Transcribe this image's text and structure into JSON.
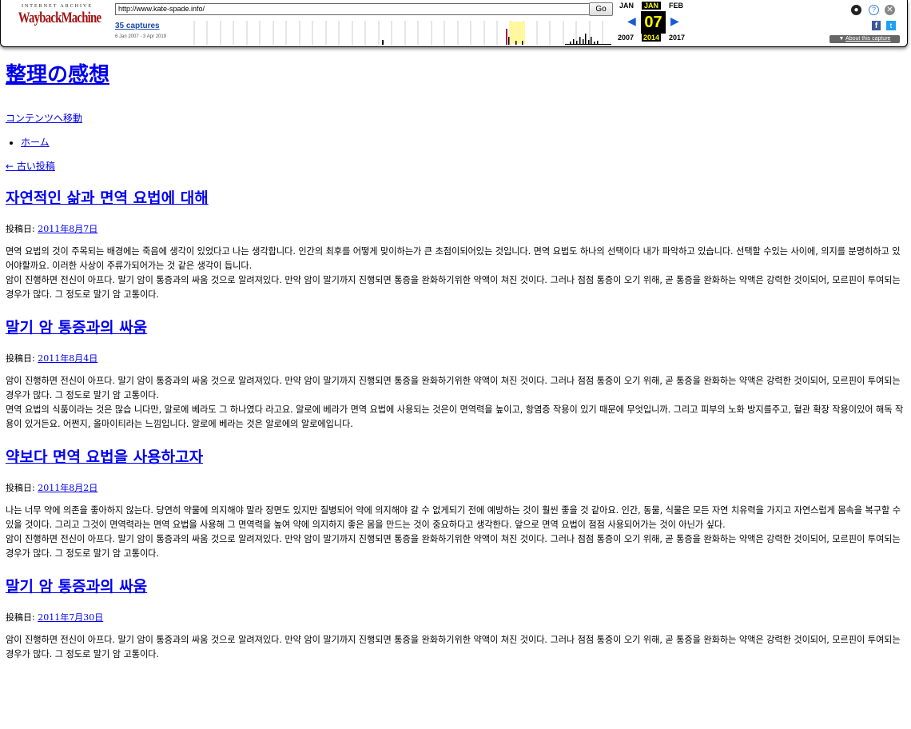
{
  "wayback": {
    "archive_label": "INTERNET ARCHIVE",
    "logo_text": "WaybackMachine",
    "url": "http://www.kate-spade.info/",
    "go_label": "Go",
    "captures": "35 captures",
    "date_range": "6 Jan 2007 - 3 Apr 2019",
    "prev_month": "JAN",
    "cur_month": "JAN",
    "next_month": "FEB",
    "cur_day": "07",
    "prev_year": "2007",
    "cur_year": "2014",
    "next_year": "2017",
    "about_label": "About this capture",
    "colors": {
      "logo": "#a31212",
      "highlight_bg": "#000000",
      "highlight_fg": "#ffff00",
      "link": "#1a48a8"
    },
    "icons": [
      "user-icon",
      "help-icon",
      "close-icon",
      "facebook-icon",
      "twitter-icon"
    ]
  },
  "site": {
    "title": "整理の感想",
    "skip_link": "コンテンツへ移動",
    "nav_items": [
      "ホーム"
    ],
    "older_posts": "← 古い投稿"
  },
  "posts": [
    {
      "title": "자연적인 삶과 면역 요법에 대해",
      "meta_label": "投稿日:",
      "date": "2011年8月7日",
      "paragraphs": [
        "면역 요법의 것이 주목되는 배경에는 죽음에 생각이 있었다고 나는 생각합니다. 인간의 최후를 어떻게 맞이하는가 큰 초점이되어있는 것입니다. 면역 요법도 하나의 선택이다 내가 파악하고 있습니다. 선택할 수있는 사이에, 의지를 분명히하고 있어야할까요. 이러한 사상이 주류가되어가는 것 같은 생각이 듭니다.",
        "암이 진행하면 전신이 아프다. 말기 암이 통증과의 싸움 것으로 알려져있다. 만약 암이 말기까지 진행되면 통증을 완화하기위한 약액이 쳐진 것이다. 그러나 점점 통증이 오기 위해, 곧 통증을 완화하는 약액은 강력한 것이되어, 모르핀이 투여되는 경우가 많다. 그 정도로 말기 암 고통이다."
      ]
    },
    {
      "title": "말기 암 통증과의 싸움",
      "meta_label": "投稿日:",
      "date": "2011年8月4日",
      "paragraphs": [
        "암이 진행하면 전신이 아프다. 말기 암이 통증과의 싸움 것으로 알려져있다. 만약 암이 말기까지 진행되면 통증을 완화하기위한 약액이 쳐진 것이다. 그러나 점점 통증이 오기 위해, 곧 통증을 완화하는 약액은 강력한 것이되어, 모르핀이 투여되는 경우가 많다. 그 정도로 말기 암 고통이다.",
        "면역 요법의 식품이라는 것은 많습 니다만, 알로에 베라도 그 하나였다 라고요. 알로에 베라가 면역 요법에 사용되는 것은이 면역력을 높이고, 항염증 작용이 있기 때문에 무엇입니까. 그리고 피부의 노화 방지를주고, 혈관 확장 작용이있어 해독 작용이 있거든요. 어쩐지, 올마이티라는 느낌입니다. 알로에 베라는 것은 알로에의 알로에입니다."
      ]
    },
    {
      "title": "약보다 면역 요법을 사용하고자",
      "meta_label": "投稿日:",
      "date": "2011年8月2日",
      "paragraphs": [
        "나는 너무 약에 의존을 좋아하지 않는다. 당연히 약물에 의지해야 말라 장면도 있지만 질병되어 약에 의지해야 갈 수 없게되기 전에 예방하는 것이 훨씬 좋을 것 같아요. 인간, 동물, 식물은 모든 자연 치유력을 가지고 자연스럽게 몸속을 복구할 수있을 것이다. 그리고 그것이 면역력라는 면역 요법을 사용해 그 면역력을 높여 약에 의지하지 좋은 몸을 만드는 것이 중요하다고 생각한다. 앞으로 면역 요법이 점점 사용되어가는 것이 아닌가 싶다.",
        "암이 진행하면 전신이 아프다. 말기 암이 통증과의 싸움 것으로 알려져있다. 만약 암이 말기까지 진행되면 통증을 완화하기위한 약액이 쳐진 것이다. 그러나 점점 통증이 오기 위해, 곧 통증을 완화하는 약액은 강력한 것이되어, 모르핀이 투여되는 경우가 많다. 그 정도로 말기 암 고통이다."
      ]
    },
    {
      "title": "말기 암 통증과의 싸움",
      "meta_label": "投稿日:",
      "date": "2011年7月30日",
      "paragraphs": [
        "암이 진행하면 전신이 아프다. 말기 암이 통증과의 싸움 것으로 알려져있다. 만약 암이 말기까지 진행되면 통증을 완화하기위한 약액이 쳐진 것이다. 그러나 점점 통증이 오기 위해, 곧 통증을 완화하는 약액은 강력한 것이되어, 모르핀이 투여되는 경우가 많다. 그 정도로 말기 암 고통이다."
      ]
    }
  ]
}
